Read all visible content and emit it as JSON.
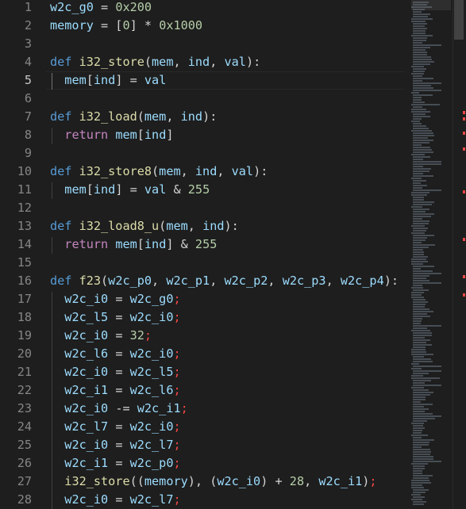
{
  "editor": {
    "active_line": 5,
    "lines": [
      {
        "n": "1",
        "tokens": [
          [
            "var",
            "w2c_g0"
          ],
          [
            "op",
            " = "
          ],
          [
            "num",
            "0x200"
          ]
        ]
      },
      {
        "n": "2",
        "tokens": [
          [
            "var",
            "memory"
          ],
          [
            "op",
            " = ["
          ],
          [
            "num",
            "0"
          ],
          [
            "op",
            "] * "
          ],
          [
            "num",
            "0x1000"
          ]
        ]
      },
      {
        "n": "3",
        "tokens": []
      },
      {
        "n": "4",
        "tokens": [
          [
            "kw",
            "def "
          ],
          [
            "fn",
            "i32_store"
          ],
          [
            "op",
            "("
          ],
          [
            "var",
            "mem"
          ],
          [
            "op",
            ", "
          ],
          [
            "var",
            "ind"
          ],
          [
            "op",
            ", "
          ],
          [
            "var",
            "val"
          ],
          [
            "op",
            "):"
          ]
        ]
      },
      {
        "n": "5",
        "tokens": [
          [
            "op",
            "  "
          ],
          [
            "var",
            "mem"
          ],
          [
            "op",
            "["
          ],
          [
            "var",
            "ind"
          ],
          [
            "op",
            "] = "
          ],
          [
            "var",
            "val"
          ]
        ]
      },
      {
        "n": "6",
        "tokens": []
      },
      {
        "n": "7",
        "tokens": [
          [
            "kw",
            "def "
          ],
          [
            "fn",
            "i32_load"
          ],
          [
            "op",
            "("
          ],
          [
            "var",
            "mem"
          ],
          [
            "op",
            ", "
          ],
          [
            "var",
            "ind"
          ],
          [
            "op",
            "):"
          ]
        ]
      },
      {
        "n": "8",
        "tokens": [
          [
            "op",
            "  "
          ],
          [
            "ctl",
            "return "
          ],
          [
            "var",
            "mem"
          ],
          [
            "op",
            "["
          ],
          [
            "var",
            "ind"
          ],
          [
            "op",
            "]"
          ]
        ]
      },
      {
        "n": "9",
        "tokens": []
      },
      {
        "n": "10",
        "tokens": [
          [
            "kw",
            "def "
          ],
          [
            "fn",
            "i32_store8"
          ],
          [
            "op",
            "("
          ],
          [
            "var",
            "mem"
          ],
          [
            "op",
            ", "
          ],
          [
            "var",
            "ind"
          ],
          [
            "op",
            ", "
          ],
          [
            "var",
            "val"
          ],
          [
            "op",
            "):"
          ]
        ]
      },
      {
        "n": "11",
        "tokens": [
          [
            "op",
            "  "
          ],
          [
            "var",
            "mem"
          ],
          [
            "op",
            "["
          ],
          [
            "var",
            "ind"
          ],
          [
            "op",
            "] = "
          ],
          [
            "var",
            "val"
          ],
          [
            "op",
            " & "
          ],
          [
            "num",
            "255"
          ]
        ]
      },
      {
        "n": "12",
        "tokens": []
      },
      {
        "n": "13",
        "tokens": [
          [
            "kw",
            "def "
          ],
          [
            "fn",
            "i32_load8_u"
          ],
          [
            "op",
            "("
          ],
          [
            "var",
            "mem"
          ],
          [
            "op",
            ", "
          ],
          [
            "var",
            "ind"
          ],
          [
            "op",
            "):"
          ]
        ]
      },
      {
        "n": "14",
        "tokens": [
          [
            "op",
            "  "
          ],
          [
            "ctl",
            "return "
          ],
          [
            "var",
            "mem"
          ],
          [
            "op",
            "["
          ],
          [
            "var",
            "ind"
          ],
          [
            "op",
            "] & "
          ],
          [
            "num",
            "255"
          ]
        ]
      },
      {
        "n": "15",
        "tokens": []
      },
      {
        "n": "16",
        "tokens": [
          [
            "kw",
            "def "
          ],
          [
            "fn",
            "f23"
          ],
          [
            "op",
            "("
          ],
          [
            "var",
            "w2c_p0"
          ],
          [
            "op",
            ", "
          ],
          [
            "var",
            "w2c_p1"
          ],
          [
            "op",
            ", "
          ],
          [
            "var",
            "w2c_p2"
          ],
          [
            "op",
            ", "
          ],
          [
            "var",
            "w2c_p3"
          ],
          [
            "op",
            ", "
          ],
          [
            "var",
            "w2c_p4"
          ],
          [
            "op",
            "):"
          ]
        ]
      },
      {
        "n": "17",
        "tokens": [
          [
            "op",
            "  "
          ],
          [
            "var",
            "w2c_i0"
          ],
          [
            "op",
            " = "
          ],
          [
            "var",
            "w2c_g0"
          ],
          [
            "err",
            ";"
          ]
        ]
      },
      {
        "n": "18",
        "tokens": [
          [
            "op",
            "  "
          ],
          [
            "var",
            "w2c_l5"
          ],
          [
            "op",
            " = "
          ],
          [
            "var",
            "w2c_i0"
          ],
          [
            "err",
            ";"
          ]
        ]
      },
      {
        "n": "19",
        "tokens": [
          [
            "op",
            "  "
          ],
          [
            "var",
            "w2c_i0"
          ],
          [
            "op",
            " = "
          ],
          [
            "num",
            "32"
          ],
          [
            "err",
            ";"
          ]
        ]
      },
      {
        "n": "20",
        "tokens": [
          [
            "op",
            "  "
          ],
          [
            "var",
            "w2c_l6"
          ],
          [
            "op",
            " = "
          ],
          [
            "var",
            "w2c_i0"
          ],
          [
            "err",
            ";"
          ]
        ]
      },
      {
        "n": "21",
        "tokens": [
          [
            "op",
            "  "
          ],
          [
            "var",
            "w2c_i0"
          ],
          [
            "op",
            " = "
          ],
          [
            "var",
            "w2c_l5"
          ],
          [
            "err",
            ";"
          ]
        ]
      },
      {
        "n": "22",
        "tokens": [
          [
            "op",
            "  "
          ],
          [
            "var",
            "w2c_i1"
          ],
          [
            "op",
            " = "
          ],
          [
            "var",
            "w2c_l6"
          ],
          [
            "err",
            ";"
          ]
        ]
      },
      {
        "n": "23",
        "tokens": [
          [
            "op",
            "  "
          ],
          [
            "var",
            "w2c_i0"
          ],
          [
            "op",
            " -= "
          ],
          [
            "var",
            "w2c_i1"
          ],
          [
            "err",
            ";"
          ]
        ]
      },
      {
        "n": "24",
        "tokens": [
          [
            "op",
            "  "
          ],
          [
            "var",
            "w2c_l7"
          ],
          [
            "op",
            " = "
          ],
          [
            "var",
            "w2c_i0"
          ],
          [
            "err",
            ";"
          ]
        ]
      },
      {
        "n": "25",
        "tokens": [
          [
            "op",
            "  "
          ],
          [
            "var",
            "w2c_i0"
          ],
          [
            "op",
            " = "
          ],
          [
            "var",
            "w2c_l7"
          ],
          [
            "err",
            ";"
          ]
        ]
      },
      {
        "n": "26",
        "tokens": [
          [
            "op",
            "  "
          ],
          [
            "var",
            "w2c_i1"
          ],
          [
            "op",
            " = "
          ],
          [
            "var",
            "w2c_p0"
          ],
          [
            "err",
            ";"
          ]
        ]
      },
      {
        "n": "27",
        "tokens": [
          [
            "op",
            "  "
          ],
          [
            "fn",
            "i32_store"
          ],
          [
            "op",
            "(("
          ],
          [
            "var",
            "memory"
          ],
          [
            "op",
            "), ("
          ],
          [
            "var",
            "w2c_i0"
          ],
          [
            "op",
            ") + "
          ],
          [
            "num",
            "28"
          ],
          [
            "op",
            ", "
          ],
          [
            "var",
            "w2c_i1"
          ],
          [
            "op",
            ")"
          ],
          [
            "err",
            ";"
          ]
        ]
      },
      {
        "n": "28",
        "tokens": [
          [
            "op",
            "  "
          ],
          [
            "var",
            "w2c_i0"
          ],
          [
            "op",
            " = "
          ],
          [
            "var",
            "w2c_l7"
          ],
          [
            "err",
            ";"
          ]
        ]
      }
    ]
  },
  "minimap": {
    "icon": "minimap"
  },
  "colors": {
    "background": "#1e1e1e",
    "keyword": "#569cd6",
    "control": "#c586c0",
    "function": "#dcdcaa",
    "number": "#b5cea8",
    "variable": "#9cdcfe",
    "error": "#f44747",
    "line_number": "#858585"
  }
}
